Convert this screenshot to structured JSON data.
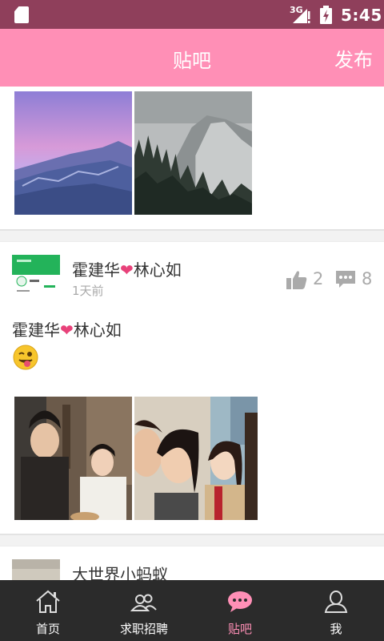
{
  "status_bar": {
    "network": "3G",
    "time": "5:45"
  },
  "header": {
    "title": "贴吧",
    "publish_label": "发布"
  },
  "posts": [
    {
      "user": "霍建华❤林心如",
      "time_ago": "1天前",
      "likes": "2",
      "comments": "8",
      "text": "霍建华❤林心如"
    },
    {
      "user": "大世界小蚂蚁"
    }
  ],
  "nav": {
    "items": [
      {
        "label": "首页",
        "icon": "home-icon"
      },
      {
        "label": "求职招聘",
        "icon": "people-icon"
      },
      {
        "label": "贴吧",
        "icon": "chat-bubble-icon"
      },
      {
        "label": "我",
        "icon": "person-icon"
      }
    ],
    "active_index": 2
  },
  "colors": {
    "accent": "#ff8fb6",
    "status_bar": "#8f3f5b",
    "nav_bg": "#2b2b2b",
    "heart": "#e8427a"
  }
}
